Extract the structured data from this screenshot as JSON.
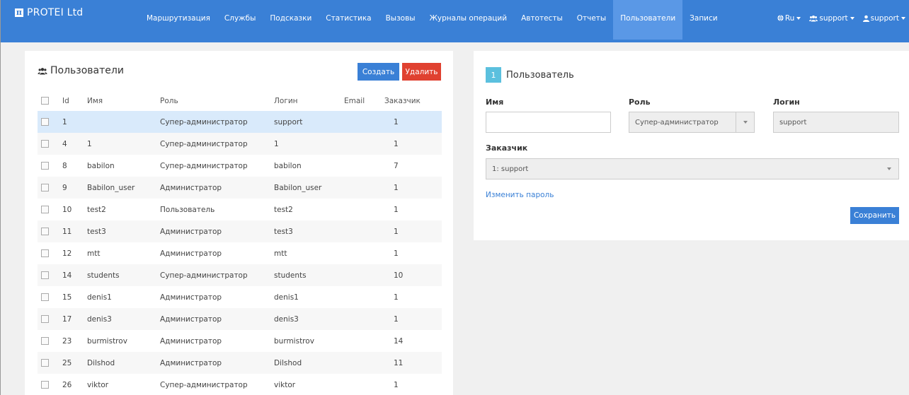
{
  "brand": {
    "logo": "π",
    "name": "PROTEI Ltd"
  },
  "nav": {
    "items": [
      {
        "label": "Маршрутизация"
      },
      {
        "label": "Службы"
      },
      {
        "label": "Подсказки"
      },
      {
        "label": "Статистика"
      },
      {
        "label": "Вызовы"
      },
      {
        "label": "Журналы операций"
      },
      {
        "label": "Автотесты"
      },
      {
        "label": "Отчеты"
      },
      {
        "label": "Пользователи",
        "active": true
      },
      {
        "label": "Записи"
      }
    ],
    "right": {
      "lang": "Ru",
      "group": "support",
      "user": "support"
    }
  },
  "users_panel": {
    "title": "Пользователи",
    "create_label": "Создать",
    "delete_label": "Удалить",
    "columns": [
      "Id",
      "Имя",
      "Роль",
      "Логин",
      "Email",
      "Заказчик"
    ],
    "rows": [
      {
        "id": "1",
        "name": "",
        "role": "Супер-администратор",
        "login": "support",
        "email": "",
        "customer": "1",
        "selected": true
      },
      {
        "id": "4",
        "name": "1",
        "role": "Супер-администратор",
        "login": "1",
        "email": "",
        "customer": "1"
      },
      {
        "id": "8",
        "name": "babilon",
        "role": "Супер-администратор",
        "login": "babilon",
        "email": "",
        "customer": "7"
      },
      {
        "id": "9",
        "name": "Babilon_user",
        "role": "Администратор",
        "login": "Babilon_user",
        "email": "",
        "customer": "1"
      },
      {
        "id": "10",
        "name": "test2",
        "role": "Пользователь",
        "login": "test2",
        "email": "",
        "customer": "1"
      },
      {
        "id": "11",
        "name": "test3",
        "role": "Администратор",
        "login": "test3",
        "email": "",
        "customer": "1"
      },
      {
        "id": "12",
        "name": "mtt",
        "role": "Администратор",
        "login": "mtt",
        "email": "",
        "customer": "1"
      },
      {
        "id": "14",
        "name": "students",
        "role": "Супер-администратор",
        "login": "students",
        "email": "",
        "customer": "10"
      },
      {
        "id": "15",
        "name": "denis1",
        "role": "Администратор",
        "login": "denis1",
        "email": "",
        "customer": "1"
      },
      {
        "id": "17",
        "name": "denis3",
        "role": "Администратор",
        "login": "denis3",
        "email": "",
        "customer": "1"
      },
      {
        "id": "23",
        "name": "burmistrov",
        "role": "Администратор",
        "login": "burmistrov",
        "email": "",
        "customer": "14"
      },
      {
        "id": "25",
        "name": "Dilshod",
        "role": "Администратор",
        "login": "Dilshod",
        "email": "",
        "customer": "11"
      },
      {
        "id": "26",
        "name": "viktor",
        "role": "Супер-администратор",
        "login": "viktor",
        "email": "",
        "customer": "1"
      }
    ]
  },
  "user_form": {
    "badge": "1",
    "title": "Пользователь",
    "name_label": "Имя",
    "name_value": "",
    "role_label": "Роль",
    "role_value": "Супер-администратор",
    "login_label": "Логин",
    "login_value": "support",
    "customer_label": "Заказчик",
    "customer_value": "1: support",
    "change_password": "Изменить пароль",
    "save_label": "Сохранить"
  },
  "colors": {
    "navbar": "#3a80d6",
    "nav_active": "#5a98e6",
    "primary": "#3a80d6",
    "danger": "#e04130",
    "badge": "#5bc0de",
    "selected_row": "#d9eafb"
  }
}
